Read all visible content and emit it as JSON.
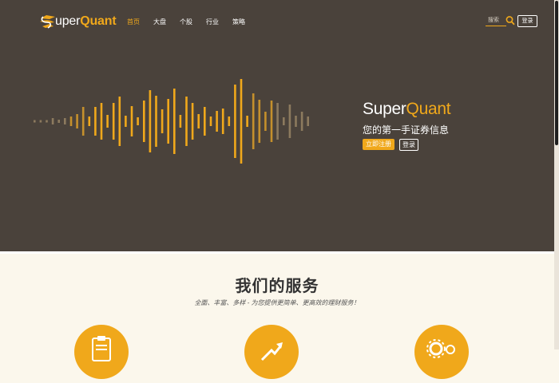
{
  "logo": {
    "text_super": "uper",
    "text_quant": "Quant"
  },
  "nav": [
    {
      "label": "首页",
      "active": true
    },
    {
      "label": "大盘",
      "active": false
    },
    {
      "label": "个股",
      "active": false
    },
    {
      "label": "行业",
      "active": false
    },
    {
      "label": "策略",
      "active": false
    }
  ],
  "search": {
    "placeholder": "搜索"
  },
  "header": {
    "login_label": "登录"
  },
  "hero": {
    "brand_super": "Super",
    "brand_quant": "Quant",
    "tagline": "您的第一手证券信息",
    "register_label": "立即注册",
    "login_label": "登录"
  },
  "services": {
    "title": "我们的服务",
    "subtitle": "全面、丰富、多样 - 为您提供更简单、更高效的理财服务！",
    "icons": [
      "clipboard-icon",
      "growth-arrow-icon",
      "gear-money-icon"
    ]
  },
  "colors": {
    "accent": "#f0a81b",
    "hero_bg": "#4a423b",
    "page_bg": "#fbf7ec"
  }
}
